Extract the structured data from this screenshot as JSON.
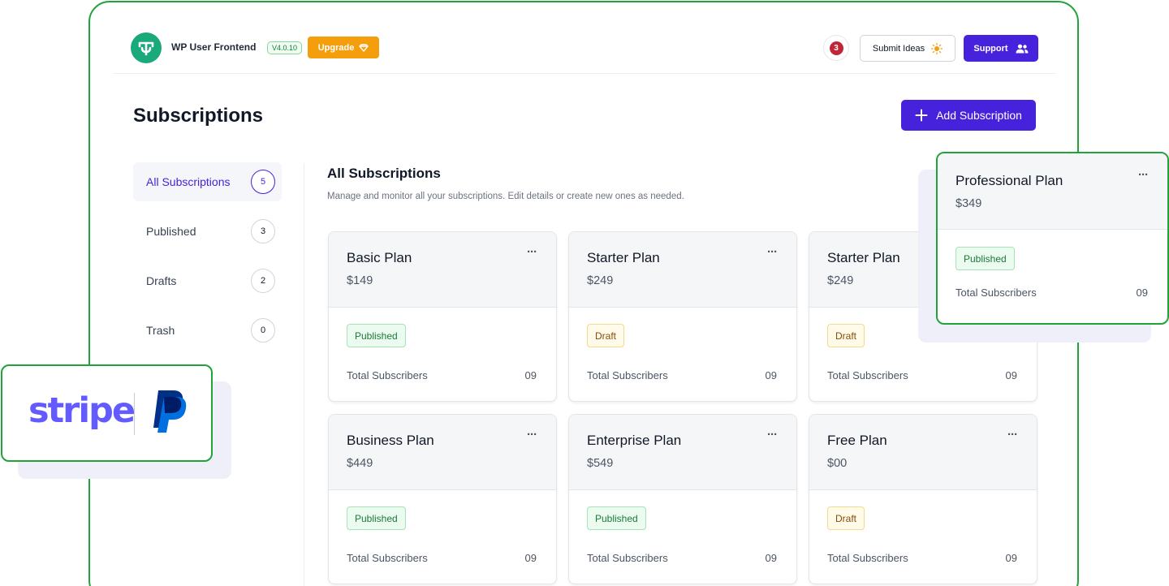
{
  "header": {
    "app_name": "WP User Frontend",
    "version": "V4.0.10",
    "upgrade_label": "Upgrade",
    "notification_count": "3",
    "submit_ideas_label": "Submit Ideas",
    "support_label": "Support"
  },
  "page": {
    "title": "Subscriptions",
    "add_button_label": "Add Subscription"
  },
  "filters": [
    {
      "label": "All Subscriptions",
      "count": "5",
      "active": true
    },
    {
      "label": "Published",
      "count": "3",
      "active": false
    },
    {
      "label": "Drafts",
      "count": "2",
      "active": false
    },
    {
      "label": "Trash",
      "count": "0",
      "active": false
    }
  ],
  "section": {
    "title": "All Subscriptions",
    "description": "Manage and monitor all your subscriptions. Edit details or create new ones as needed."
  },
  "plans": [
    {
      "name": "Basic Plan",
      "price": "$149",
      "status": "Published",
      "subscribers_label": "Total Subscribers",
      "subscribers": "09"
    },
    {
      "name": "Starter Plan",
      "price": "$249",
      "status": "Draft",
      "subscribers_label": "Total Subscribers",
      "subscribers": "09"
    },
    {
      "name": "Starter Plan",
      "price": "$249",
      "status": "Draft",
      "subscribers_label": "Total Subscribers",
      "subscribers": "09"
    },
    {
      "name": "Business Plan",
      "price": "$449",
      "status": "Published",
      "subscribers_label": "Total Subscribers",
      "subscribers": "09"
    },
    {
      "name": "Enterprise Plan",
      "price": "$549",
      "status": "Published",
      "subscribers_label": "Total Subscribers",
      "subscribers": "09"
    },
    {
      "name": "Free Plan",
      "price": "$00",
      "status": "Draft",
      "subscribers_label": "Total Subscribers",
      "subscribers": "09"
    }
  ],
  "featured_plan": {
    "name": "Professional Plan",
    "price": "$349",
    "status": "Published",
    "subscribers_label": "Total Subscribers",
    "subscribers": "09"
  },
  "payment_methods": {
    "stripe": "stripe",
    "paypal_icon": "paypal-icon"
  },
  "more_glyph": "···",
  "colors": {
    "accent": "#4722dc",
    "upgrade": "#f59e0b",
    "highlight_border": "#22a33a",
    "logo_green": "#19a97b",
    "stripe": "#635bff"
  }
}
